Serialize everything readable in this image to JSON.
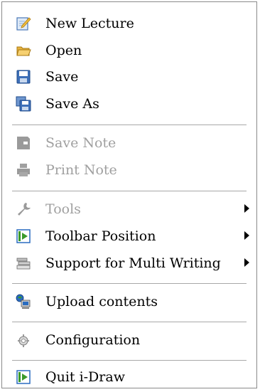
{
  "menu": {
    "items": {
      "new_lecture": {
        "label": "New Lecture",
        "icon": "new-lecture-icon",
        "enabled": true
      },
      "open": {
        "label": "Open",
        "icon": "open-folder-icon",
        "enabled": true
      },
      "save": {
        "label": "Save",
        "icon": "save-disk-icon",
        "enabled": true
      },
      "save_as": {
        "label": "Save As",
        "icon": "save-as-icon",
        "enabled": true
      },
      "save_note": {
        "label": "Save Note",
        "icon": "save-note-icon",
        "enabled": false
      },
      "print_note": {
        "label": "Print Note",
        "icon": "print-note-icon",
        "enabled": false
      },
      "tools": {
        "label": "Tools",
        "icon": "wrench-icon",
        "enabled": false,
        "has_submenu": true
      },
      "toolbar_position": {
        "label": "Toolbar Position",
        "icon": "toolbar-position-icon",
        "enabled": true,
        "has_submenu": true
      },
      "support_multi_writing": {
        "label": "Support for Multi Writing",
        "icon": "multi-writing-icon",
        "enabled": true,
        "has_submenu": true
      },
      "upload_contents": {
        "label": "Upload contents",
        "icon": "upload-computer-icon",
        "enabled": true
      },
      "configuration": {
        "label": "Configuration",
        "icon": "gear-icon",
        "enabled": true
      },
      "quit": {
        "label": "Quit i-Draw",
        "icon": "quit-icon",
        "enabled": true
      }
    }
  },
  "colors": {
    "text": "#000000",
    "disabled_text": "#a0a0a0",
    "border": "#8a8a8a",
    "separator": "#a8a8a8",
    "accent_green": "#3a9a2a",
    "accent_blue": "#2a6cc0"
  }
}
